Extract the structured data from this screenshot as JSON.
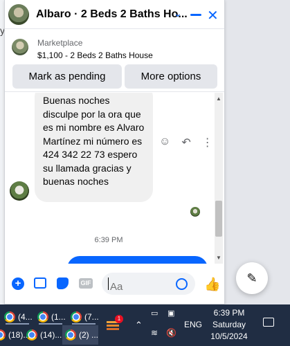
{
  "chat": {
    "title": "Albaro · 2 Beds 2 Baths Ho...",
    "listing": {
      "source_label": "Marketplace",
      "title": "$1,100 - 2 Beds 2 Baths House",
      "mark_pending_label": "Mark as pending",
      "more_options_label": "More options"
    },
    "messages": [
      {
        "direction": "incoming",
        "text": "Buenas noches disculpe por la ora que es mi nombre es Alvaro Martínez mi número es 424 342 22 73 espero su llamada gracias y buenas noches"
      }
    ],
    "timestamp": "6:39 PM",
    "composer": {
      "placeholder": "Aa",
      "gif_label": "GIF"
    }
  },
  "taskbar": {
    "apps": [
      {
        "label": "(4..."
      },
      {
        "label": "(1..."
      },
      {
        "label": "(7..."
      },
      {
        "label": "(18)..."
      },
      {
        "label": "(14)..."
      },
      {
        "label": "(2) ..."
      }
    ],
    "notification_badge": "1",
    "language": "ENG",
    "clock": {
      "time": "6:39 PM",
      "day": "Saturday",
      "date": "10/5/2024"
    }
  },
  "colors": {
    "accent": "#0866ff",
    "taskbar": "#202d43",
    "bubble_incoming": "#f0f0f0"
  }
}
